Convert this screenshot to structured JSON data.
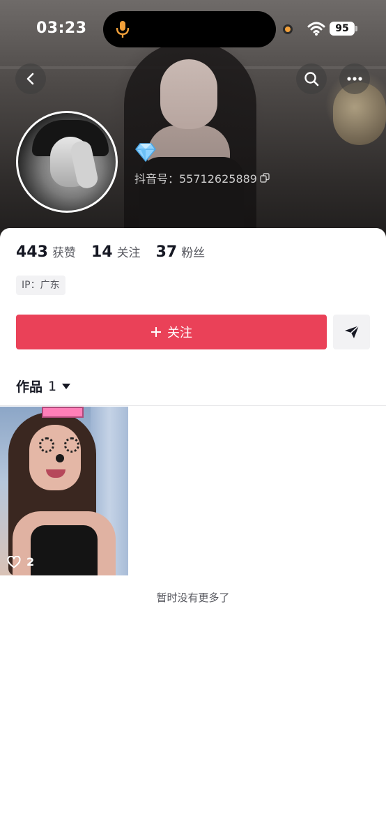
{
  "status_bar": {
    "time": "03:23",
    "battery": "95",
    "icons": [
      "mic-icon",
      "wifi-icon"
    ]
  },
  "nav": {
    "icons": [
      "back-icon",
      "search-icon",
      "more-icon"
    ]
  },
  "profile": {
    "badge_icon": "diamond-icon",
    "douyin_id": "抖音号：55712625889"
  },
  "stats": [
    {
      "num": "443",
      "label": "获赞"
    },
    {
      "num": "14",
      "label": "关注"
    },
    {
      "num": "37",
      "label": "粉丝"
    }
  ],
  "ip": "IP：广东",
  "actions": {
    "follow_label": "关注",
    "follow_color": "#ea4158"
  },
  "works": {
    "tab_label": "作品",
    "count": "1"
  },
  "videos": [
    {
      "likes": "2"
    }
  ],
  "footer": {
    "no_more": "暂时没有更多了"
  }
}
